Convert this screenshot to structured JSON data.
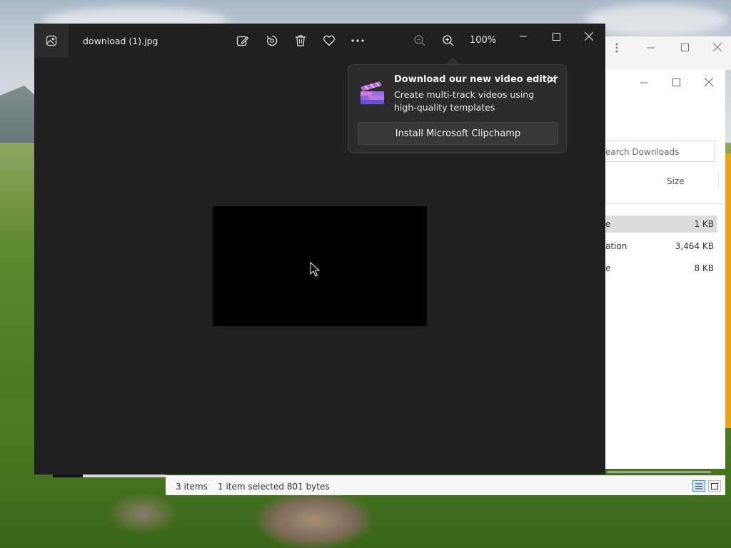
{
  "viewer": {
    "file_title": "download (1).jpg",
    "zoom_level": "100%",
    "toolbar": {
      "edit_icon": "edit-image-icon",
      "rotate_icon": "rotate-icon",
      "delete_icon": "delete-icon",
      "favorite_icon": "heart-icon",
      "more_icon": "more-options-icon",
      "zoom_out_icon": "zoom-out-icon",
      "zoom_in_icon": "zoom-in-icon"
    },
    "colors": {
      "background": "#202020",
      "titlebar_icon_bg": "#2a2a2a",
      "image_bg": "#000000"
    }
  },
  "popup": {
    "title": "Download our new video editor",
    "body": "Create multi-track videos using high-quality templates",
    "button_label": "Install Microsoft Clipchamp",
    "icon": "clipchamp-icon"
  },
  "explorer": {
    "search_placeholder": "earch Downloads",
    "column_size": "Size",
    "rows": [
      {
        "name": "e",
        "size": "1 KB",
        "selected": true
      },
      {
        "name": "ation",
        "size": "3,464 KB",
        "selected": false
      },
      {
        "name": "e",
        "size": "8 KB",
        "selected": false
      }
    ],
    "status": {
      "items": "3 items",
      "selection": "1 item selected  801 bytes"
    },
    "colors": {
      "accent": "#e8a317",
      "selected_row": "#dcdcdc"
    }
  }
}
